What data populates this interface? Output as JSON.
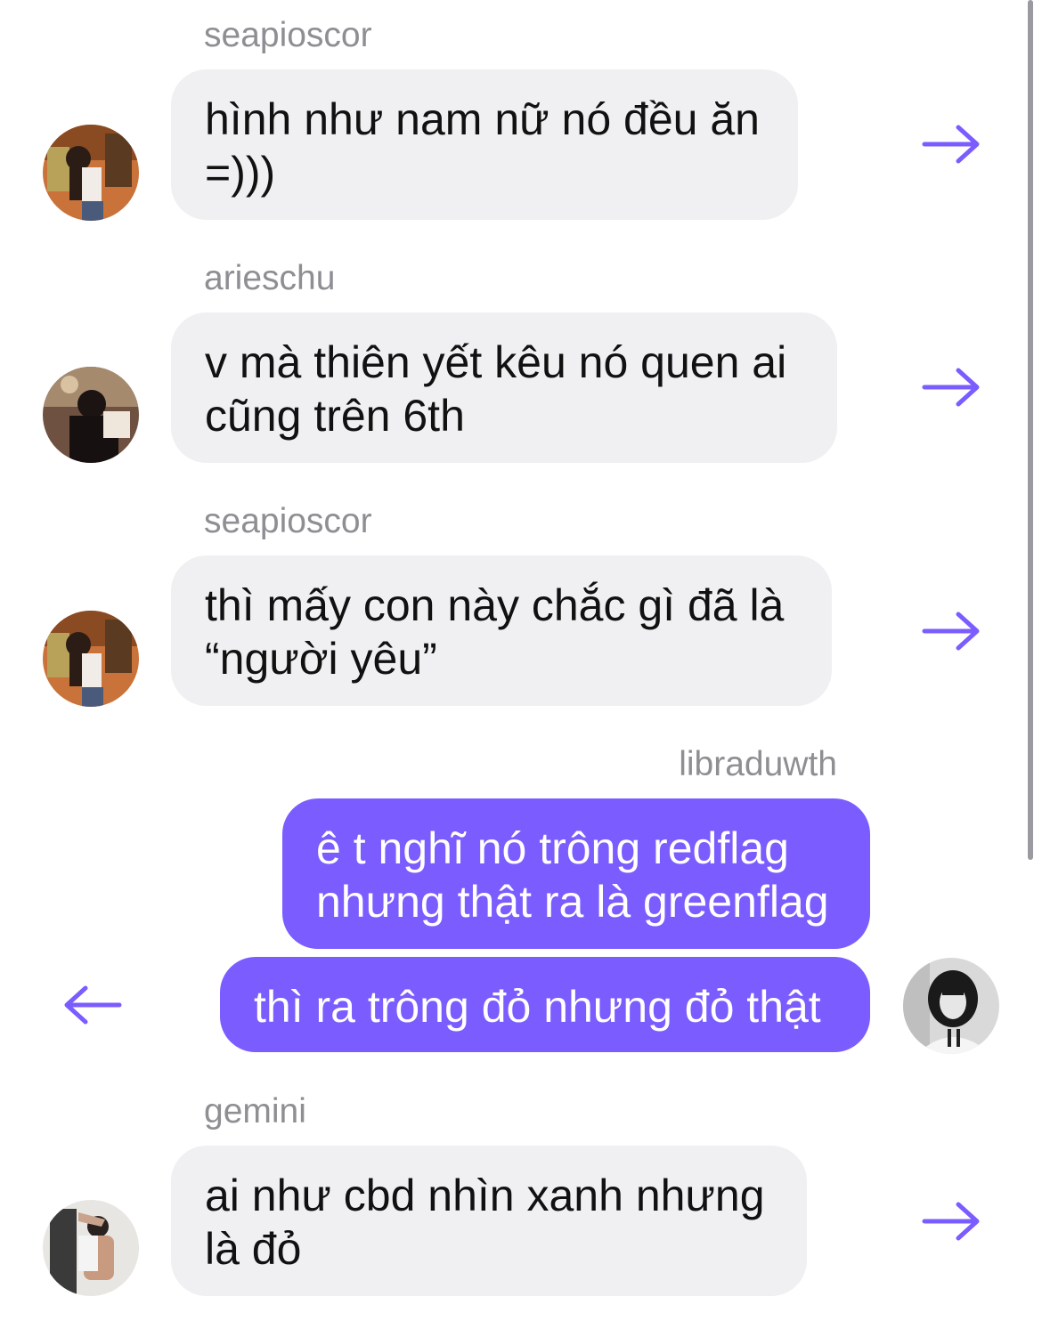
{
  "accent_color": "#7b5cff",
  "incoming_bubble_color": "#f0f0f2",
  "messages": [
    {
      "sender": "seapioscor",
      "direction": "incoming",
      "lines": [
        "hình như nam nữ nó đều ăn",
        "=)))"
      ],
      "avatar": "avatar-girl-photo",
      "action_icon": "forward-arrow-icon"
    },
    {
      "sender": "arieschu",
      "direction": "incoming",
      "lines": [
        "v mà thiên yết kêu nó quen ai",
        "cũng trên 6th"
      ],
      "avatar": "avatar-dark-photo",
      "action_icon": "forward-arrow-icon"
    },
    {
      "sender": "seapioscor",
      "direction": "incoming",
      "lines": [
        "thì mấy con này chắc gì đã là",
        "“người yêu”"
      ],
      "avatar": "avatar-girl-photo",
      "action_icon": "forward-arrow-icon"
    },
    {
      "sender": "libraduwth",
      "direction": "outgoing",
      "lines": [
        "ê t nghĩ nó trông redflag",
        "nhưng thật ra là greenflag"
      ]
    },
    {
      "sender": "",
      "direction": "outgoing",
      "lines": [
        "thì ra trông đỏ nhưng đỏ thật"
      ],
      "avatar": "avatar-hoodie-photo",
      "action_icon": "reply-arrow-icon"
    },
    {
      "sender": "gemini",
      "direction": "incoming",
      "lines": [
        "ai như cbd nhìn xanh nhưng",
        "là đỏ"
      ],
      "avatar": "avatar-room-photo",
      "action_icon": "forward-arrow-icon"
    }
  ]
}
